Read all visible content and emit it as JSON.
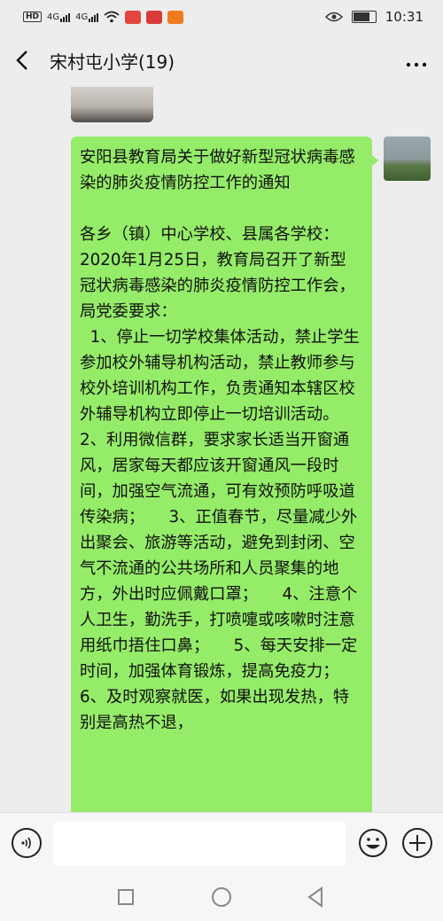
{
  "status_bar": {
    "hd_label": "HD",
    "sim1": "4G",
    "sim2": "4G",
    "time": "10:31",
    "icons": [
      "hd-icon",
      "signal-icon",
      "signal-icon",
      "wifi-icon",
      "app-notification-icon",
      "app-notification-icon",
      "app-notification-icon",
      "eye-icon",
      "battery-icon"
    ]
  },
  "header": {
    "title": "宋村屯小学(19)",
    "back_icon": "chevron-left-icon",
    "more_icon": "more-dots-icon"
  },
  "chat": {
    "message": "安阳县教育局关于做好新型冠状病毒感染的肺炎疫情防控工作的通知\n\n各乡（镇）中心学校、县属各学校：　　2020年1月25日，教育局召开了新型冠状病毒感染的肺炎疫情防控工作会，局党委要求：\n  1、停止一切学校集体活动，禁止学生参加校外辅导机构活动，禁止教师参与校外培训机构工作，负责通知本辖区校外辅导机构立即停止一切培训活动。\n2、利用微信群，要求家长适当开窗通风，居家每天都应该开窗通风一段时间，加强空气流通，可有效预防呼吸道传染病；　　3、正值春节，尽量减少外出聚会、旅游等活动，避免到封闭、空气不流通的公共场所和人员聚集的地方，外出时应佩戴口罩；　　4、注意个人卫生，勤洗手，打喷嚏或咳嗽时注意用纸巾捂住口鼻；　　5、每天安排一定时间，加强体育锻炼，提高免疫力；　6、及时观察就医，如果出现发热，特别是高热不退，"
  },
  "input_bar": {
    "voice_icon": "voice-icon",
    "emoji_icon": "emoji-icon",
    "plus_icon": "plus-icon",
    "input_value": ""
  },
  "system_nav": {
    "icons": [
      "recent-apps-icon",
      "home-icon",
      "back-icon"
    ]
  },
  "colors": {
    "background": "#ededed",
    "bubble": "#95ec69",
    "bar": "#f6f6f6"
  }
}
